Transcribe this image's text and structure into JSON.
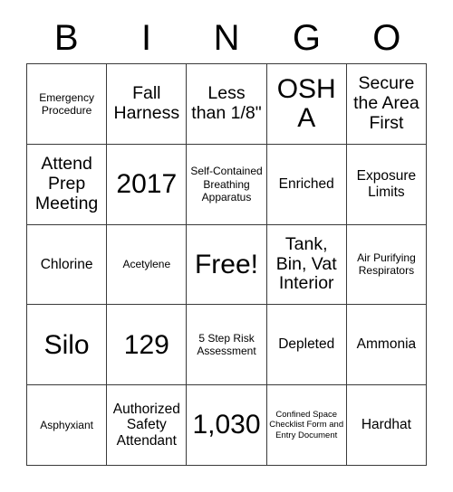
{
  "card": {
    "title": "BINGO",
    "header_letters": [
      "B",
      "I",
      "N",
      "G",
      "O"
    ],
    "border_color": "#3a3a3a",
    "text_color": "#000000",
    "background_color": "#ffffff",
    "rows": 5,
    "columns": 5,
    "cells": [
      [
        {
          "text": "Emergency Procedure",
          "size": "sm"
        },
        {
          "text": "Fall Harness",
          "size": "lg"
        },
        {
          "text": "Less than 1/8\"",
          "size": "lg"
        },
        {
          "text": "OSHA",
          "size": "xl"
        },
        {
          "text": "Secure the Area First",
          "size": "lg"
        }
      ],
      [
        {
          "text": "Attend Prep Meeting",
          "size": "lg"
        },
        {
          "text": "2017",
          "size": "xl"
        },
        {
          "text": "Self-Contained Breathing Apparatus",
          "size": "sm"
        },
        {
          "text": "Enriched",
          "size": "md"
        },
        {
          "text": "Exposure Limits",
          "size": "md"
        }
      ],
      [
        {
          "text": "Chlorine",
          "size": "md"
        },
        {
          "text": "Acetylene",
          "size": "sm"
        },
        {
          "text": "Free!",
          "size": "xl"
        },
        {
          "text": "Tank, Bin, Vat Interior",
          "size": "lg"
        },
        {
          "text": "Air Purifying Respirators",
          "size": "sm"
        }
      ],
      [
        {
          "text": "Silo",
          "size": "xl"
        },
        {
          "text": "129",
          "size": "xl"
        },
        {
          "text": "5 Step Risk Assessment",
          "size": "sm"
        },
        {
          "text": "Depleted",
          "size": "md"
        },
        {
          "text": "Ammonia",
          "size": "md"
        }
      ],
      [
        {
          "text": "Asphyxiant",
          "size": "sm"
        },
        {
          "text": "Authorized Safety Attendant",
          "size": "md"
        },
        {
          "text": "1,030",
          "size": "xl"
        },
        {
          "text": "Confined Space Checklist Form and Entry Document",
          "size": "xs"
        },
        {
          "text": "Hardhat",
          "size": "md"
        }
      ]
    ]
  }
}
